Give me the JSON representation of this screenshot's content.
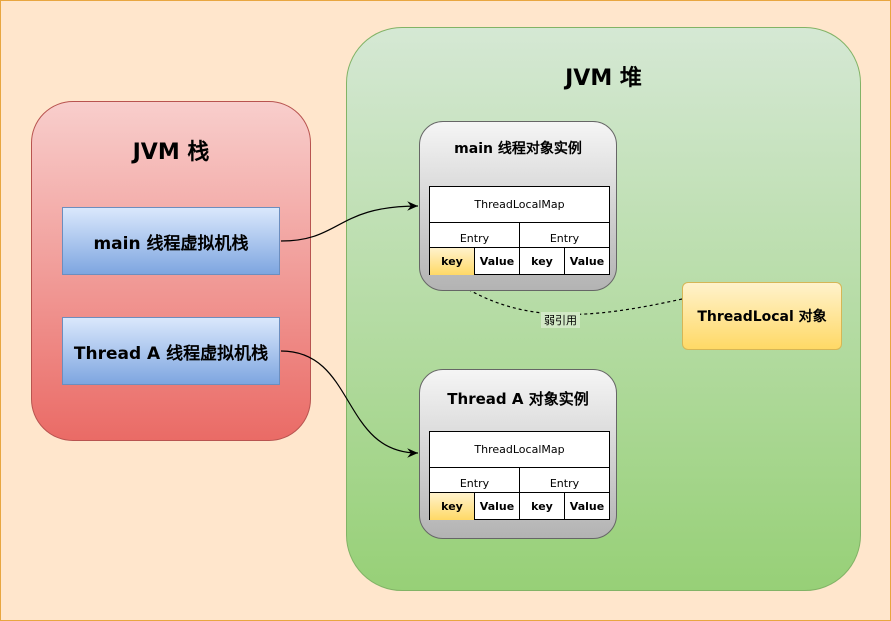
{
  "jvm_stack": {
    "title": "JVM 栈",
    "frames": [
      {
        "label": "main 线程虚拟机栈"
      },
      {
        "label": "Thread A 线程虚拟机栈"
      }
    ]
  },
  "jvm_heap": {
    "title": "JVM 堆",
    "instances": [
      {
        "title": "main 线程对象实例",
        "map_label": "ThreadLocalMap",
        "entries": [
          "Entry",
          "Entry"
        ],
        "cells": [
          "key",
          "Value",
          "key",
          "Value"
        ]
      },
      {
        "title": "Thread A 对象实例",
        "map_label": "ThreadLocalMap",
        "entries": [
          "Entry",
          "Entry"
        ],
        "cells": [
          "key",
          "Value",
          "key",
          "Value"
        ]
      }
    ],
    "threadlocal_object": "ThreadLocal 对象"
  },
  "edges": {
    "weak_ref_label": "弱引用"
  },
  "colors": {
    "background": "#ffe6cc",
    "stack_fill": "#f8cecc",
    "heap_fill": "#d5e8d4",
    "frame_fill": "#dae8fc",
    "key_fill": "#ffd966"
  }
}
